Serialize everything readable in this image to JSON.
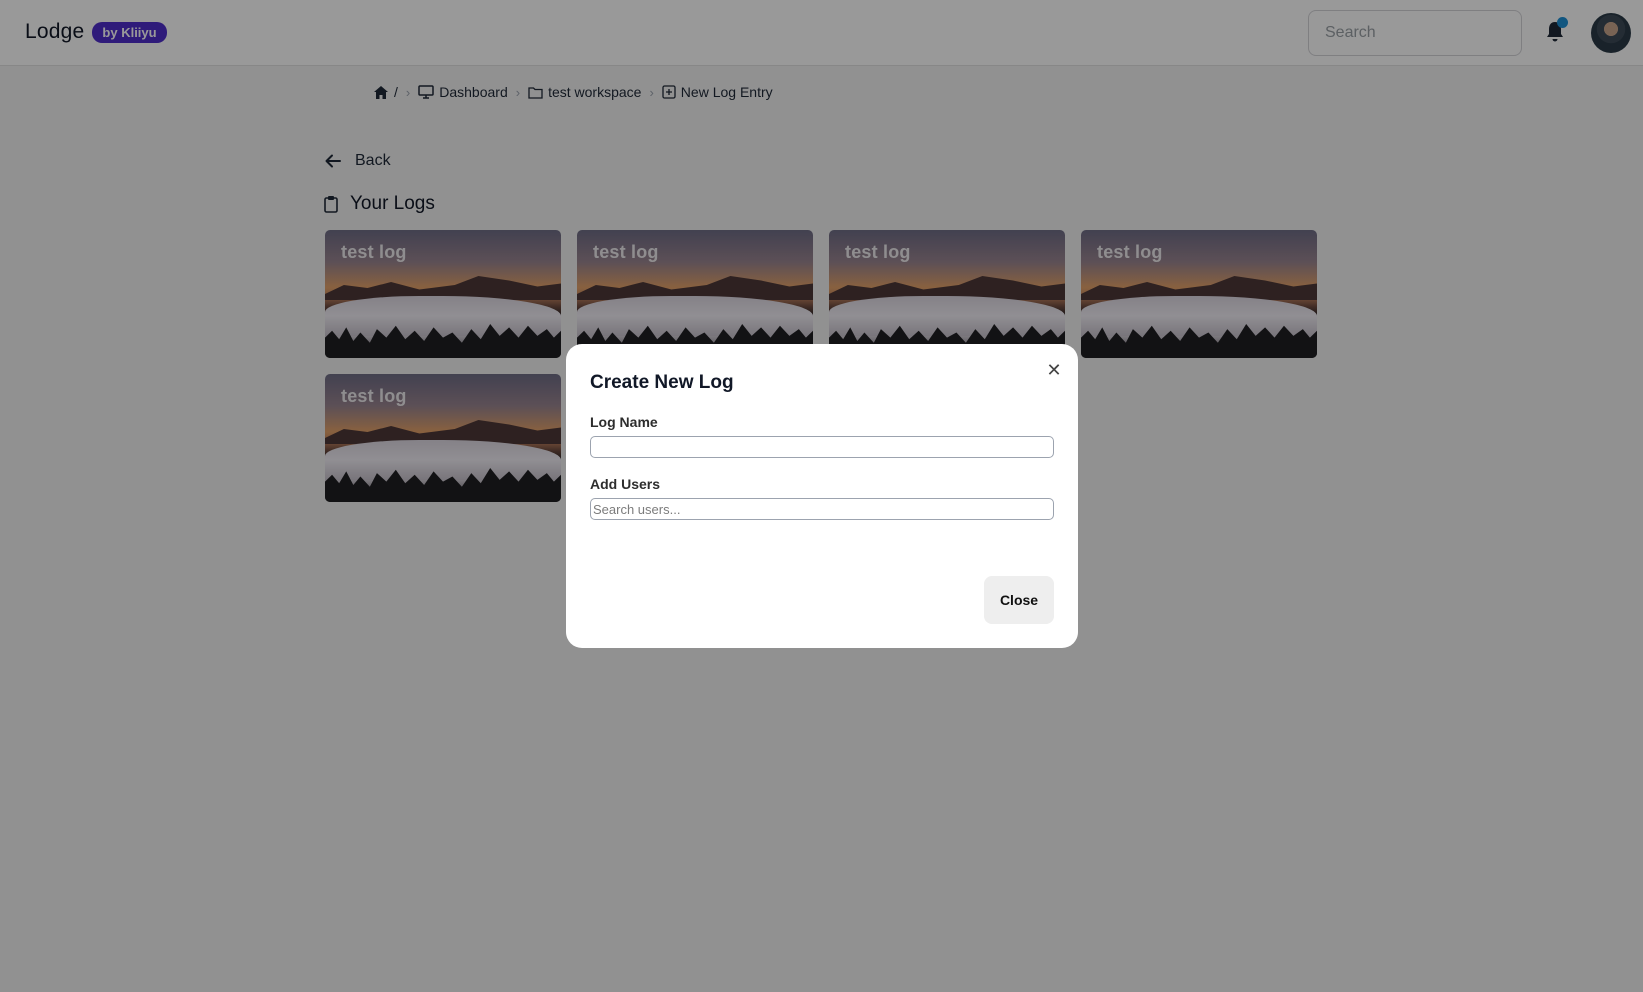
{
  "navbar": {
    "brand": "Lodge",
    "badge": "by Kliiyu",
    "search_placeholder": "Search",
    "notification_icon": "bell-icon",
    "accent_color": "#4f2ecc",
    "dot_color": "#1d8fd6"
  },
  "breadcrumb": {
    "home_icon": "home-icon",
    "root": "/",
    "items": [
      {
        "icon": "monitor-icon",
        "label": "Dashboard"
      },
      {
        "icon": "folder-icon",
        "label": "test workspace"
      },
      {
        "icon": "plus-square-icon",
        "label": "New Log Entry"
      }
    ]
  },
  "main": {
    "back_label": "Back",
    "section_title": "Your Logs",
    "logs": [
      {
        "title": "test log"
      },
      {
        "title": "test log"
      },
      {
        "title": "test log"
      },
      {
        "title": "test log"
      },
      {
        "title": "test log"
      }
    ]
  },
  "modal": {
    "title": "Create New Log",
    "log_name_label": "Log Name",
    "log_name_value": "",
    "add_users_label": "Add Users",
    "add_users_placeholder": "Search users...",
    "close_label": "Close"
  }
}
